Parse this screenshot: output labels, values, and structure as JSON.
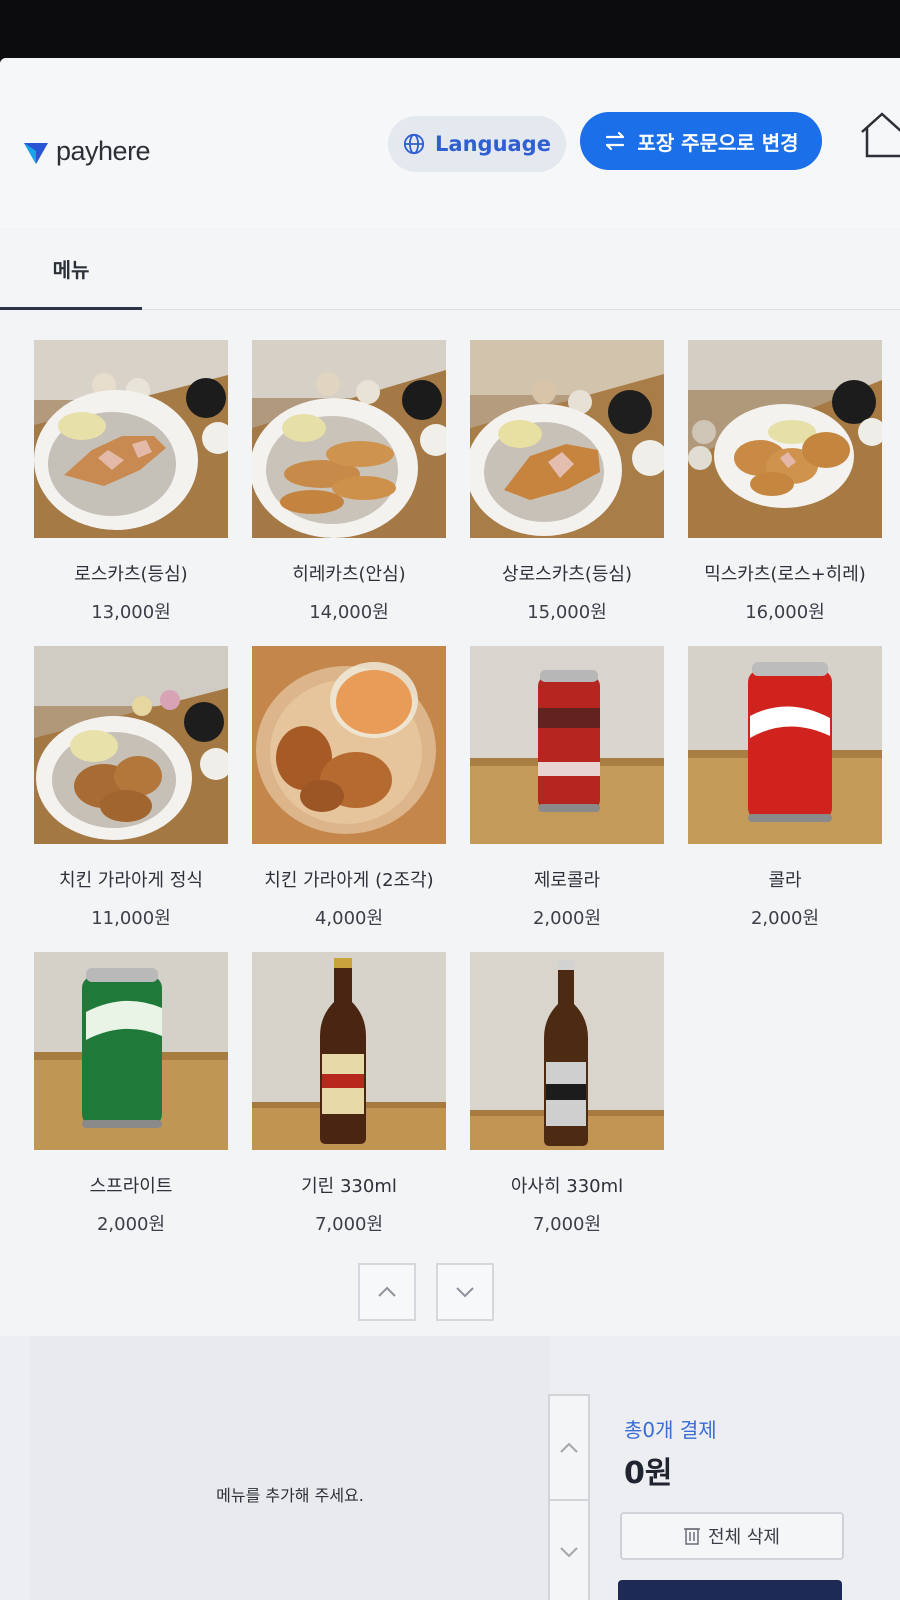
{
  "header": {
    "logo_text": "payhere",
    "language_label": "Language",
    "takeout_label": "포장 주문으로 변경"
  },
  "tabs": [
    {
      "label": "메뉴"
    }
  ],
  "menu": [
    {
      "name": "로스카츠(등심)",
      "price": "13,000원",
      "photo": "pork-cutlet-set-photo"
    },
    {
      "name": "히레카츠(안심)",
      "price": "14,000원",
      "photo": "tenderloin-cutlet-set-photo"
    },
    {
      "name": "상로스카츠(등심)",
      "price": "15,000원",
      "photo": "premium-loin-cutlet-set-photo"
    },
    {
      "name": "믹스카츠(로스+히레)",
      "price": "16,000원",
      "photo": "mixed-cutlet-set-photo"
    },
    {
      "name": "치킨 가라아게 정식",
      "price": "11,000원",
      "photo": "chicken-karaage-set-photo"
    },
    {
      "name": "치킨 가라아게 (2조각)",
      "price": "4,000원",
      "photo": "chicken-karaage-photo"
    },
    {
      "name": "제로콜라",
      "price": "2,000원",
      "photo": "coca-cola-zero-can-photo"
    },
    {
      "name": "콜라",
      "price": "2,000원",
      "photo": "coca-cola-can-photo"
    },
    {
      "name": "스프라이트",
      "price": "2,000원",
      "photo": "sprite-can-photo"
    },
    {
      "name": "기린 330ml",
      "price": "7,000원",
      "photo": "kirin-beer-bottle-photo"
    },
    {
      "name": "아사히 330ml",
      "price": "7,000원",
      "photo": "asahi-beer-bottle-photo"
    }
  ],
  "cart": {
    "empty_message": "메뉴를 추가해 주세요.",
    "count_label": "총0개 결제",
    "total": "0원",
    "clear_label": "전체 삭제"
  },
  "colors": {
    "accent": "#1b6fe8",
    "language_text": "#2f5fd0",
    "pay_button": "#1d2a55"
  }
}
